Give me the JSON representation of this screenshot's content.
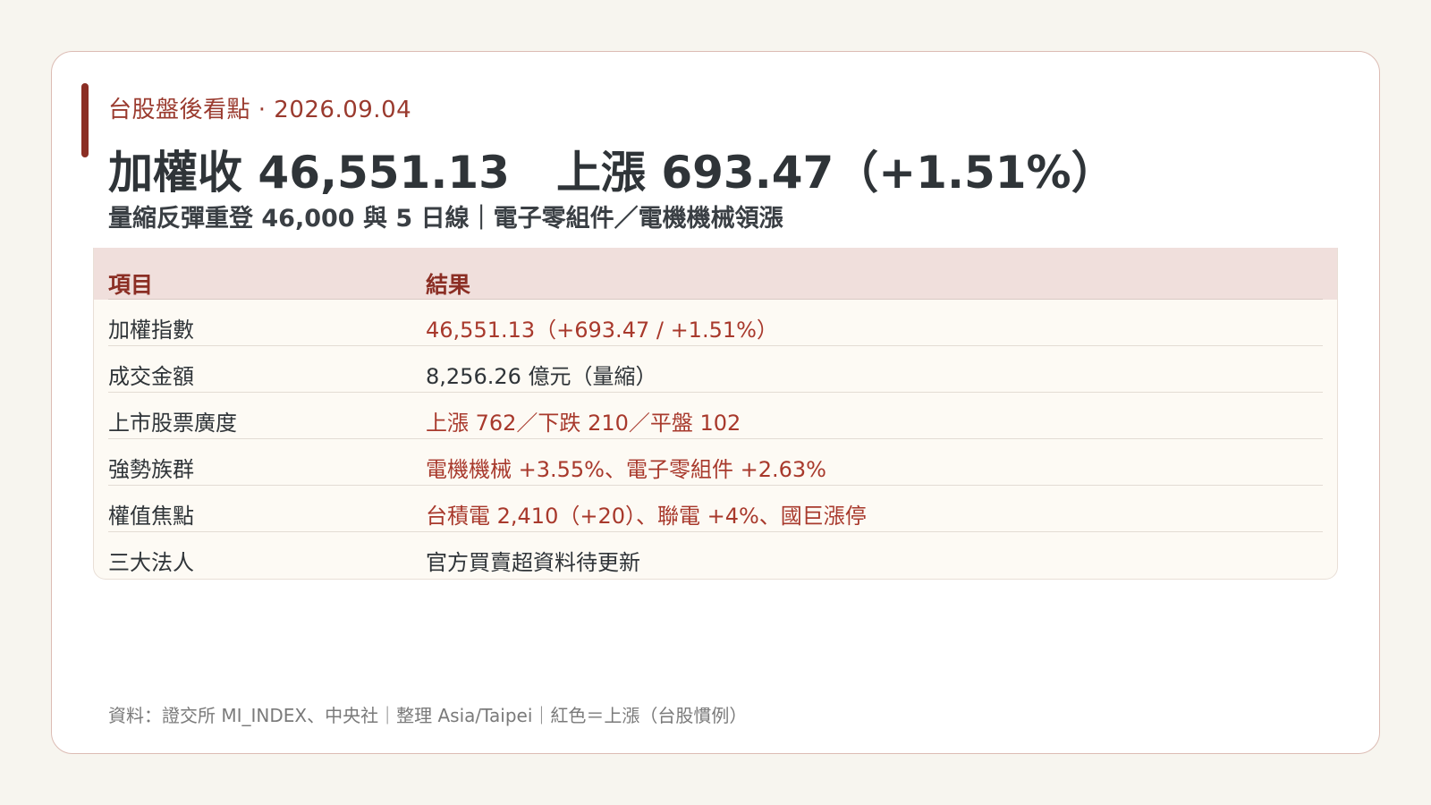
{
  "header": {
    "kicker": "台股盤後看點 · 2026.09.04",
    "headline_close": "加權收 46,551.13",
    "headline_change": "上漲 693.47（+1.51%）",
    "subhead": "量縮反彈重登 46,000 與 5 日線｜電子零組件／電機機械領漲"
  },
  "table": {
    "columns": [
      "項目",
      "結果"
    ],
    "rows": [
      {
        "item": "加權指數",
        "result": "46,551.13（+693.47 / +1.51%）",
        "up": true
      },
      {
        "item": "成交金額",
        "result": "8,256.26 億元（量縮）",
        "up": false
      },
      {
        "item": "上市股票廣度",
        "result": "上漲 762／下跌 210／平盤 102",
        "up": true
      },
      {
        "item": "強勢族群",
        "result": "電機機械 +3.55%、電子零組件 +2.63%",
        "up": true
      },
      {
        "item": "權值焦點",
        "result": "台積電 2,410（+20）、聯電 +4%、國巨漲停",
        "up": true
      },
      {
        "item": "三大法人",
        "result": "官方買賣超資料待更新",
        "up": false
      }
    ]
  },
  "footer": {
    "source": "資料：證交所 MI_INDEX、中央社｜整理 Asia/Taipei｜紅色＝上漲（台股慣例）"
  },
  "colors": {
    "accent": "#8b2e24",
    "up": "#a8392c",
    "header_row_bg": "#f0dfdc",
    "card_border": "#dcbcb4"
  }
}
